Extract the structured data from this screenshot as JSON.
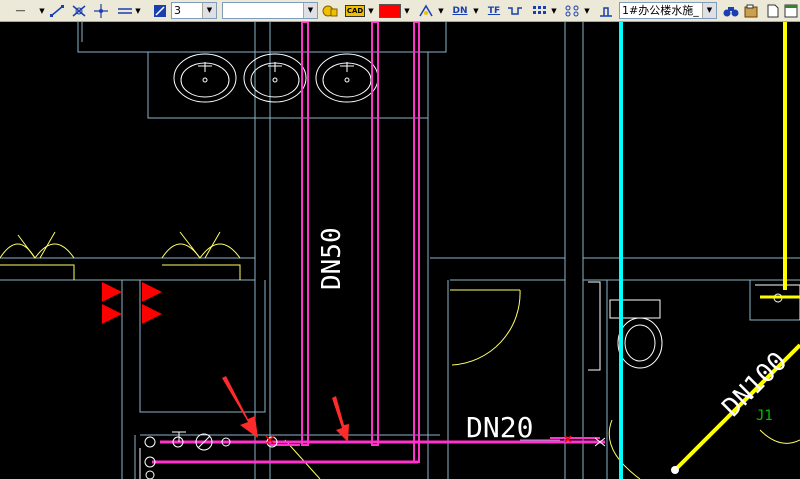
{
  "toolbar": {
    "linetype_label": "----",
    "lineweight_value": "3",
    "layer_value": "",
    "cad_label": "CAD",
    "color_value": "#ff0000",
    "dn_label": "DN",
    "tf_label": "TF",
    "drawing_combo_value": "1#办公楼水施_",
    "icons": [
      "linetype-icon",
      "snap-icon",
      "endpoint-icon",
      "intersect-icon",
      "line-icon",
      "zoom-window-icon",
      "layer-lock-icon",
      "cad-icon",
      "color-icon",
      "pipe-icon",
      "dn-icon",
      "tf-icon",
      "fitting-icon",
      "grid-icon",
      "dots-icon",
      "valve-icon",
      "binoculars-icon",
      "properties-icon",
      "document-icon",
      "spreadsheet-icon"
    ]
  },
  "drawing": {
    "labels": {
      "dn50": "DN50",
      "dn20": "DN20",
      "dn100": "DN100",
      "j1": "J1"
    },
    "colors": {
      "background": "#000000",
      "pipe": "#ff33cc",
      "riser": "#00ffff",
      "drain": "#ffff00",
      "wall": "#8ab4c8",
      "fixture": "#ffffff",
      "door": "#ffff66",
      "marker": "#ff0000"
    }
  }
}
